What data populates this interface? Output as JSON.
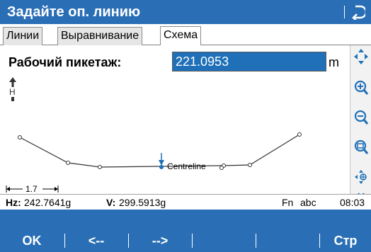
{
  "window": {
    "title": "Задайте оп. линию",
    "back_icon": "back-arrow-icon"
  },
  "tabs": [
    {
      "label": "Линии",
      "active": false
    },
    {
      "label": "Выравнивание",
      "active": false
    },
    {
      "label": "Схема",
      "active": true
    }
  ],
  "station": {
    "label": "Рабочий пикетаж:",
    "value": "221.0953",
    "unit": "m"
  },
  "diagram": {
    "north_label": "H",
    "centreline_label": "Centreline",
    "scale_label": "1.7"
  },
  "toolbar": {
    "icons": [
      "pan-arrows-icon",
      "zoom-in-icon",
      "zoom-out-icon",
      "zoom-fit-icon",
      "center-target-icon",
      "expand-chevron-icon"
    ]
  },
  "status": {
    "hz_label": "Hz:",
    "hz_value": "242.7641g",
    "v_label": "V:",
    "v_value": "299.5913g",
    "fn": "Fn",
    "mode": "abc",
    "time": "08:03"
  },
  "softkeys": {
    "k1": "OK",
    "k2": "<--",
    "k3": "-->",
    "k4": "",
    "k5": "",
    "k6": "Стр"
  },
  "colors": {
    "title_bg": "#2a6fb6",
    "input_bg": "#1f70b8",
    "accent_blue": "#1f70b8"
  }
}
